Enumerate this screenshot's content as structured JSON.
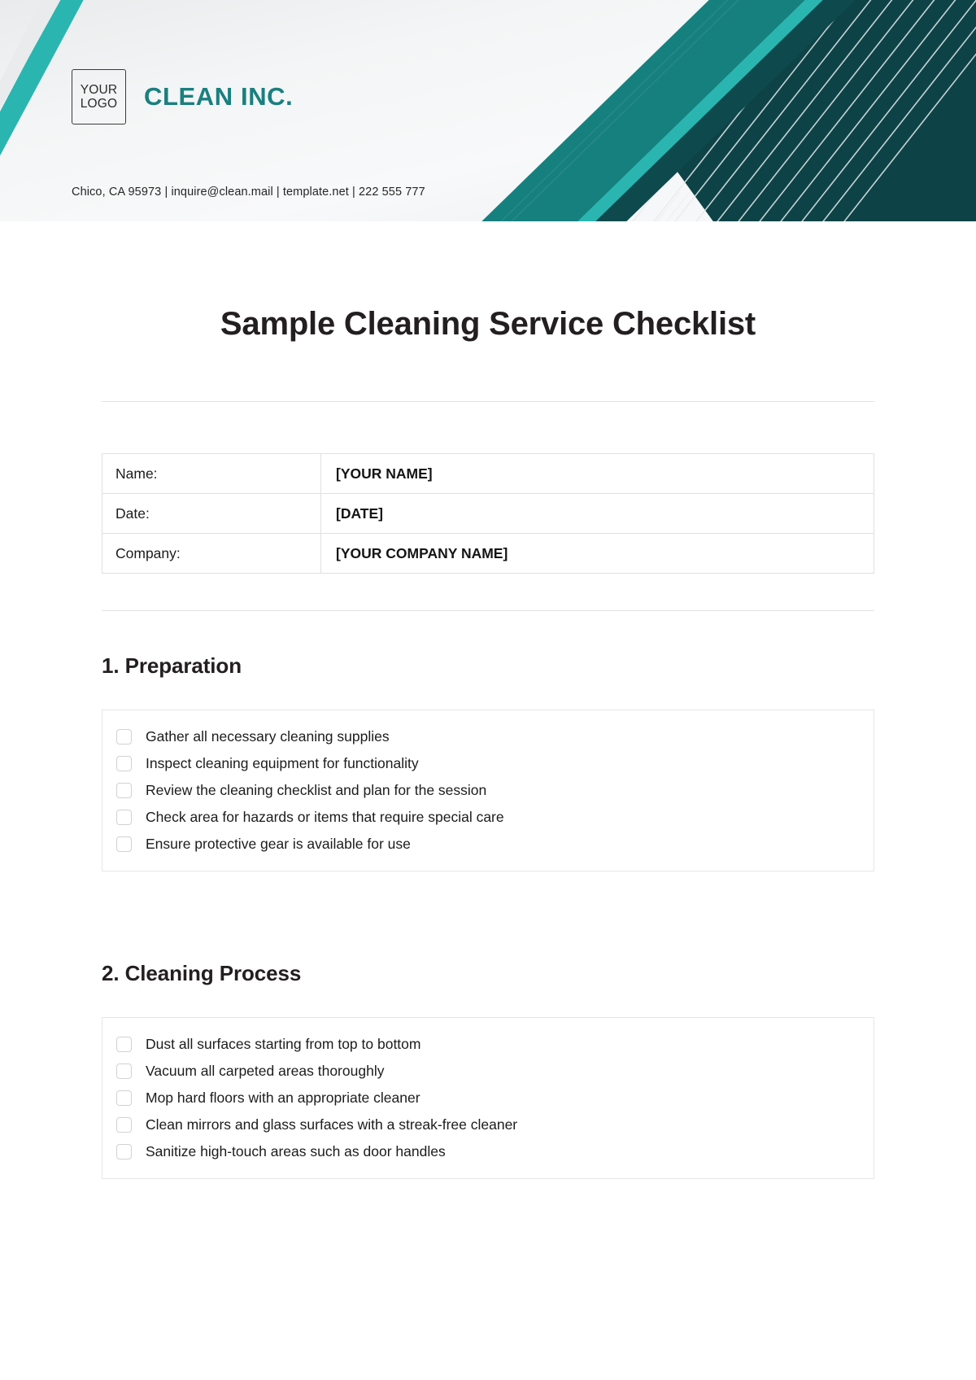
{
  "header": {
    "logo_line1": "YOUR",
    "logo_line2": "LOGO",
    "brand": "CLEAN INC.",
    "contact": "Chico, CA 95973 | inquire@clean.mail | template.net | 222 555 777",
    "colors": {
      "brand_teal": "#1a7f7f",
      "band_teal": "#16807f",
      "bright_cyan": "#2bb5b0",
      "dark_teal": "#0d4347",
      "background_light": "#f2f4f5"
    }
  },
  "document": {
    "title": "Sample Cleaning Service Checklist"
  },
  "info": {
    "rows": [
      {
        "label": "Name:",
        "value": "[YOUR NAME]"
      },
      {
        "label": "Date:",
        "value": "[DATE]"
      },
      {
        "label": "Company:",
        "value": "[YOUR COMPANY NAME]"
      }
    ]
  },
  "sections": [
    {
      "heading": "1. Preparation",
      "items": [
        "Gather all necessary cleaning supplies",
        "Inspect cleaning equipment for functionality",
        "Review the cleaning checklist and plan for the session",
        "Check area for hazards or items that require special care",
        "Ensure protective gear is available for use"
      ]
    },
    {
      "heading": "2. Cleaning Process",
      "items": [
        "Dust all surfaces starting from top to bottom",
        "Vacuum all carpeted areas thoroughly",
        "Mop hard floors with an appropriate cleaner",
        "Clean mirrors and glass surfaces with a streak-free cleaner",
        "Sanitize high-touch areas such as door handles"
      ]
    }
  ]
}
